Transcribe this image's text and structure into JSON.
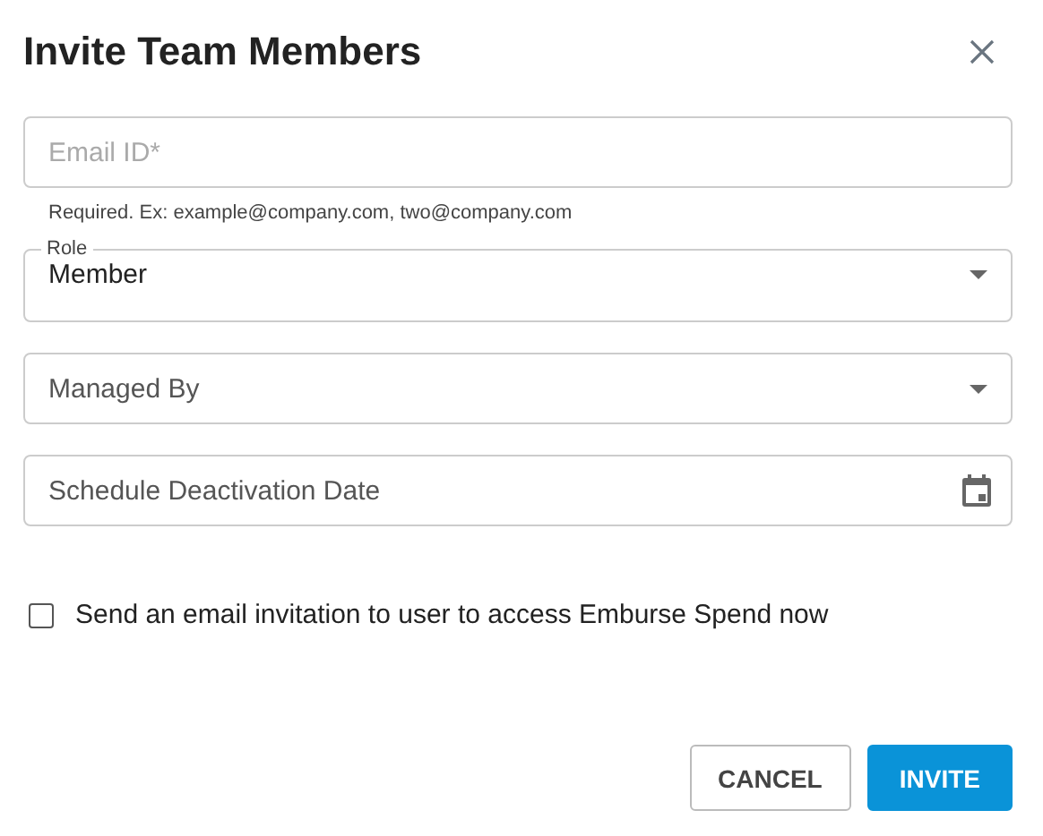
{
  "dialog": {
    "title": "Invite Team Members"
  },
  "fields": [
    {
      "kind": "text",
      "placeholder": "Email ID*",
      "helper": "Required. Ex: example@company.com, two@company.com"
    },
    {
      "kind": "select",
      "label": "Role",
      "value": "Member"
    },
    {
      "kind": "select",
      "placeholder": "Managed By"
    },
    {
      "kind": "date",
      "placeholder": "Schedule Deactivation Date"
    }
  ],
  "invitation": {
    "label": "Send an email invitation to user to access Emburse Spend now",
    "checked": false
  },
  "buttons": [
    {
      "label": "CANCEL",
      "kind": "secondary"
    },
    {
      "label": "INVITE",
      "kind": "primary"
    }
  ]
}
